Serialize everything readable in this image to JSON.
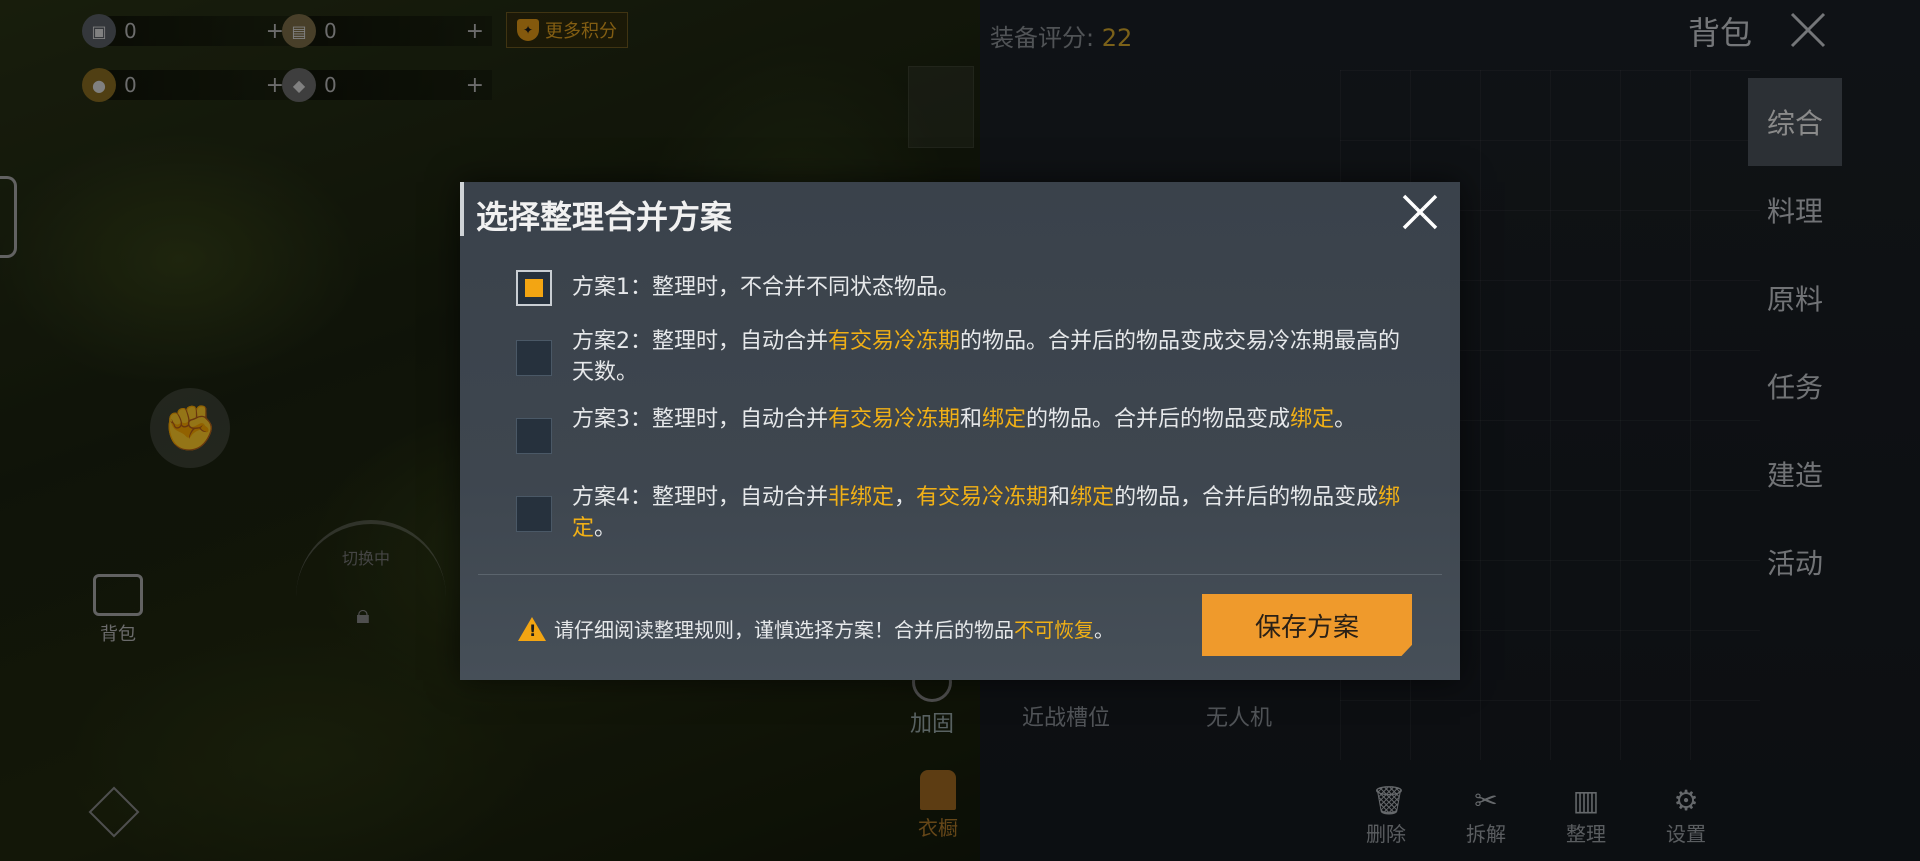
{
  "currencies": [
    {
      "icon": "parts-icon",
      "value": "0",
      "plus": "+",
      "color": "#9aa2aa"
    },
    {
      "icon": "ticket-icon",
      "value": "0",
      "plus": "+",
      "color": "#b8a070"
    },
    {
      "icon": "coin-icon",
      "value": "0",
      "plus": "+",
      "color": "#c8a040"
    },
    {
      "icon": "gem-icon",
      "value": "0",
      "plus": "+",
      "color": "#bfbfbf"
    }
  ],
  "more_points": "更多积分",
  "equip_score": {
    "label": "装备评分: ",
    "value": "22"
  },
  "bag_title": "背包",
  "categories": [
    "综合",
    "料理",
    "原料",
    "任务",
    "建造",
    "活动"
  ],
  "side": {
    "bag": "背包",
    "dial": "切换中"
  },
  "slots": {
    "melee": "近战槽位",
    "drone": "无人机",
    "reinforce": "加固",
    "wardrobe": "衣橱"
  },
  "tools": [
    {
      "icon": "trash-icon",
      "label": "删除"
    },
    {
      "icon": "wrench-icon",
      "label": "拆解"
    },
    {
      "icon": "sort-icon",
      "label": "整理"
    },
    {
      "icon": "gear-icon",
      "label": "设置"
    }
  ],
  "dialog": {
    "title": "选择整理合并方案",
    "options": [
      {
        "checked": true,
        "parts": [
          "方案1：整理时，不合并不同状态物品。"
        ]
      },
      {
        "checked": false,
        "parts": [
          "方案2：整理时，自动合并",
          "有交易冷冻期",
          "的物品。合并后的物品变成交易冷冻期最高的天数。"
        ]
      },
      {
        "checked": false,
        "parts": [
          "方案3：整理时，自动合并",
          "有交易冷冻期",
          "和",
          "绑定",
          "的物品。合并后的物品变成",
          "绑定",
          "。"
        ]
      },
      {
        "checked": false,
        "parts": [
          "方案4：整理时，自动合并",
          "非绑定",
          "，",
          "有交易冷冻期",
          "和",
          "绑定",
          "的物品，合并后的物品变成",
          "绑定",
          "。"
        ]
      }
    ],
    "warning": {
      "prefix": "请仔细阅读整理规则，谨慎选择方案！合并后的物品",
      "highlight": "不可恢复",
      "suffix": "。"
    },
    "save_label": "保存方案"
  },
  "colors": {
    "accent": "#f1b016",
    "button": "#ef9a2c"
  }
}
